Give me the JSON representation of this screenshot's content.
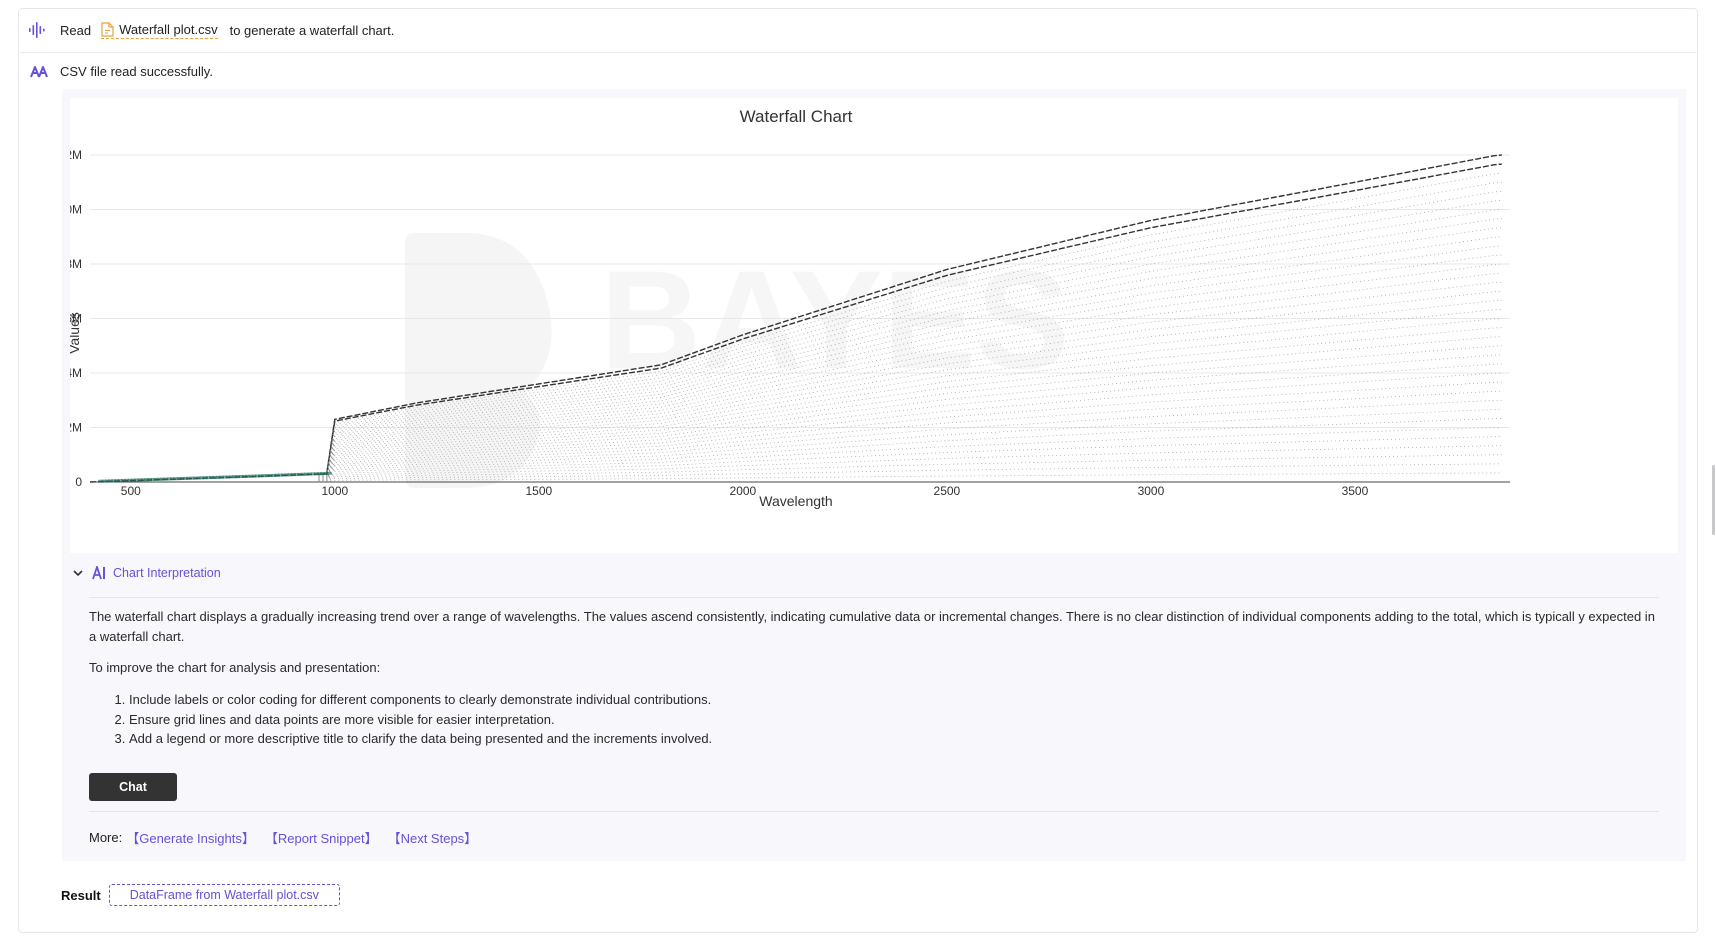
{
  "header": {
    "read_label": "Read",
    "file_name": "Waterfall plot.csv",
    "rest_text": "to generate a waterfall chart."
  },
  "status": {
    "message": "CSV file read successfully."
  },
  "chart_data": {
    "type": "line",
    "title": "Waterfall Chart",
    "xlabel": "Wavelength",
    "ylabel": "Values",
    "x_ticks": [
      500,
      1000,
      1500,
      2000,
      2500,
      3000,
      3500
    ],
    "y_ticks": [
      "0",
      "2M",
      "4M",
      "6M",
      "8M",
      "0M",
      "2M"
    ],
    "xlim": [
      400,
      3880
    ],
    "ylim": [
      0,
      12000000
    ],
    "grid": true,
    "legend": "none",
    "series_count": 36,
    "top_series": {
      "x": [
        400,
        600,
        800,
        980,
        990,
        1000,
        1200,
        1500,
        1800,
        2000,
        2500,
        3000,
        3500,
        3850
      ],
      "y": [
        0,
        100000,
        200000,
        300000,
        2000000,
        2300000,
        2900000,
        3600000,
        4300000,
        5400000,
        7800000,
        9600000,
        11000000,
        12000000
      ]
    }
  },
  "interpretation": {
    "heading": "Chart Interpretation",
    "paragraph": "The waterfall chart displays a gradually increasing trend over a range of wavelengths. The values ascend consistently, indicating cumulative data or incremental changes. There is no clear distinction of individual components adding to the total, which is typicall y expected in a waterfall chart.",
    "improve_intro": "To improve the chart for analysis and presentation:",
    "items": [
      "Include labels or color coding for different components to clearly demonstrate individual contributions.",
      "Ensure grid lines and data points are more visible for easier interpretation.",
      "Add a legend or more descriptive title to clarify the data being presented and the increments involved."
    ]
  },
  "chat_button": "Chat",
  "more": {
    "label": "More:",
    "links": [
      "【Generate Insights】",
      "【Report Snippet】",
      "【Next Steps】"
    ]
  },
  "result": {
    "label": "Result",
    "chip": "DataFrame from Waterfall plot.csv"
  },
  "colors": {
    "accent": "#6a4fd8",
    "file_underline": "#e6a23c",
    "button_bg": "#333333",
    "series_main": "#333333",
    "series_point": "#1f6b5a"
  }
}
